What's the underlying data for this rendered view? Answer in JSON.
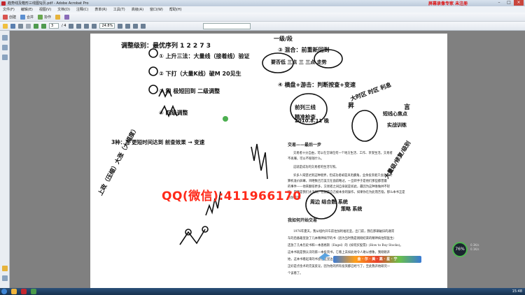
{
  "window": {
    "title": "趋势线及箱形三线图SJ页.pdf - Adobe Acrobat Pro",
    "watermark": "屏幕录像专家 未注册",
    "minimize": "–",
    "maximize": "□",
    "close": "×"
  },
  "menu": [
    "文件(F)",
    "编辑(E)",
    "视图(V)",
    "文档(D)",
    "注释(C)",
    "表单(R)",
    "工具(T)",
    "高级(A)",
    "窗口(W)",
    "帮助(H)"
  ],
  "toolbar1": {
    "create_label": "创建",
    "combine_label": "合并",
    "collab_label": "协作"
  },
  "toolbar2": {
    "page_current": "3",
    "page_total": "/ 4",
    "zoom_value": "24.8%"
  },
  "handwriting": {
    "title_left": "调整级别：最优序列 1 2 2 7 3",
    "line1": "① 上升三法：大量线（接着线）验证",
    "line2": "② 下打（大量K线）破M 20见生",
    "line3": "③ 和 极短回到 二级调整",
    "line4": "④ 四级调整",
    "top_right_title": "一级/段",
    "tr_line1": "③ 混合：前重新回到",
    "tr_line2": "要否低 三点 三 三点 走势",
    "tr_line3": "④ 横盘+游击：判断按查+变速",
    "date": "2010.8.11 晚",
    "note_middle": "3种：① 更短时间达到 前查效果 → 变速",
    "left_vertical": "上政（压缩）大涨（大幅度）",
    "center_diag": "大时区 时区 利息",
    "center_box1": "前列三线",
    "center_box2": "精准检查",
    "center_label_sheng": "昇",
    "center_label_yan": "言",
    "right_side1": "短线心焦点",
    "right_side2": "实战训练",
    "right_vertical": "大量级/修复/级别",
    "lower_note": "周边 结合数 系统",
    "lower_note2": "策略 系统"
  },
  "overlay": {
    "qq_text": "QQ(微信):411966170"
  },
  "printed_text": {
    "heading": "交易——最后一步",
    "para1_l1": "交易者十分自由，可以在全球任何一个地方生活、工作、享受生活。交易者",
    "para1_l2": "不再赚，可以不赔钱什么。",
    "para2": "这就是成功的交易者的生活写照。",
    "para3_l1": "许多人渴望达到这种境界，但成功者却是凤毛麟角，业余投资者只会盲目计",
    "para3_l2": "算机准价屏幕，目瞪数百万美元在面前略过，一旦转手于是他们那些都曾最",
    "para3_l3": "的事件——他来翻倍更多，交易者之间自身就是如此，最因为这种谁做并不轻",
    "para3_l4": "快，安健是我们太无知，也就是自己被本身的操作，如果你在为此而苦恼，那么本书正是",
    "para3_l5": "为你而写。",
    "heading2": "我如何开始交易",
    "para4_l1": "1976年夏天，我从纽约开车前往加利福尼亚。出门前，我在那辆破旧的通常",
    "para4_l2": "车的后备箱里放了几本精神病学的书（因为当时我是刚刚结束的精神病住院医生）",
    "para4_l3": "还放了几本历史书和一本恩格斯（Engel）的《如何买股票》(How to Buy Stocks)。",
    "para4_l4": "这本书就是我认识的第一本投资书，它看上去如此地令人难以想象。我刚刚开",
    "para4_l5": "始，这本书看起来的书会在这里边是已经学了非常的关于上的，目前的股市后",
    "para4_l6": "正好是点金术的完美反证，因为他的所有投资都已经亏了，至此我开始研究一",
    "para4_l7": "个该看了。"
  },
  "system": {
    "cpu_percent": "76%",
    "up_speed": "0.3K/s",
    "down_speed": "0.1K/s",
    "clock": "15:48",
    "logo_text": "金 · 尔 · 美 · 高 · 星 · 宁"
  }
}
